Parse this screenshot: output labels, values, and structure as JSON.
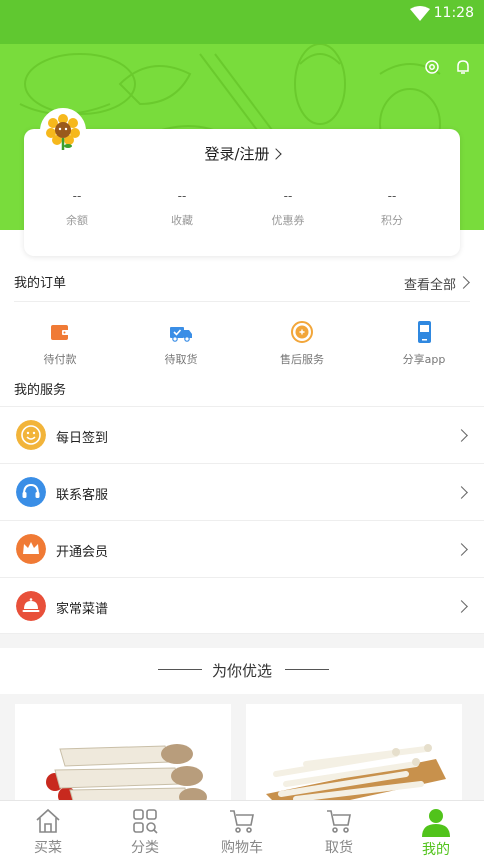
{
  "status_bar": {
    "time": "11:28"
  },
  "profile": {
    "login_label": "登录/注册"
  },
  "stats": [
    {
      "value": "--",
      "label": "余额"
    },
    {
      "value": "--",
      "label": "收藏"
    },
    {
      "value": "--",
      "label": "优惠券"
    },
    {
      "value": "--",
      "label": "积分"
    }
  ],
  "orders": {
    "title": "我的订单",
    "view_all": "查看全部",
    "items": [
      {
        "label": "待付款",
        "icon": "wallet-icon",
        "color": "#f07a35"
      },
      {
        "label": "待取货",
        "icon": "truck-icon",
        "color": "#3a8ee6"
      },
      {
        "label": "售后服务",
        "icon": "after-sale-icon",
        "color": "#f2a63a"
      },
      {
        "label": "分享app",
        "icon": "phone-app-icon",
        "color": "#2f88e0"
      }
    ]
  },
  "services": {
    "title": "我的服务",
    "items": [
      {
        "label": "每日签到",
        "icon": "smile-icon",
        "color": "#f2b43a"
      },
      {
        "label": "联系客服",
        "icon": "headset-icon",
        "color": "#3a8ee6"
      },
      {
        "label": "开通会员",
        "icon": "crown-icon",
        "color": "#f07a35"
      },
      {
        "label": "家常菜谱",
        "icon": "dish-icon",
        "color": "#e8503a"
      }
    ]
  },
  "recommend": {
    "title": "为你优选"
  },
  "tabs": [
    {
      "label": "买菜",
      "icon": "home-icon"
    },
    {
      "label": "分类",
      "icon": "category-icon"
    },
    {
      "label": "购物车",
      "icon": "cart-icon"
    },
    {
      "label": "取货",
      "icon": "pickup-cart-icon"
    },
    {
      "label": "我的",
      "icon": "user-icon",
      "active": true
    }
  ],
  "colors": {
    "brand_green": "#79dc3c",
    "active_tab": "#51c31b"
  }
}
